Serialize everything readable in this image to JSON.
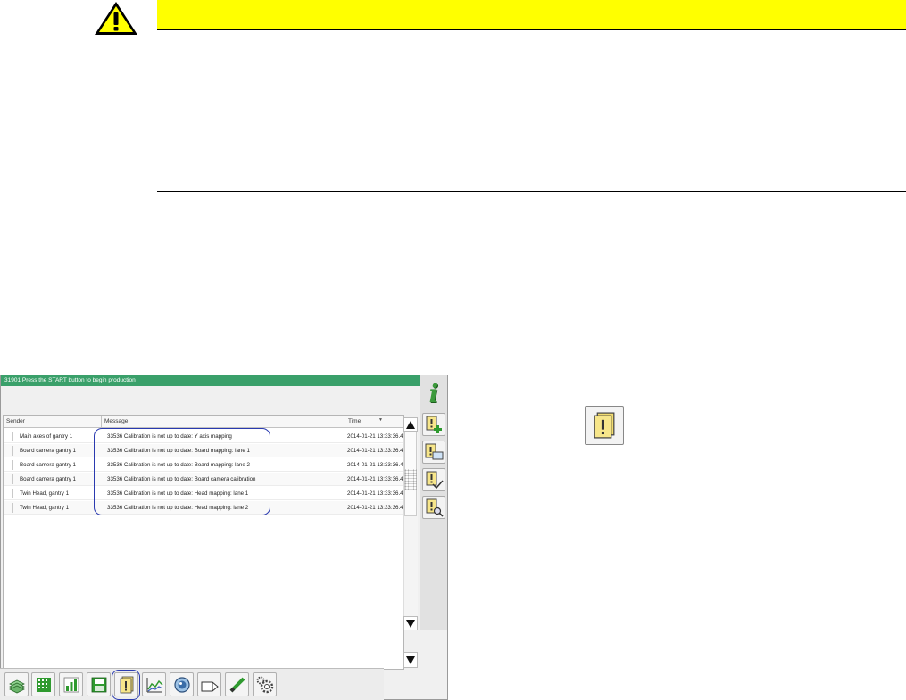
{
  "warning": {
    "icon": "warning-triangle-icon"
  },
  "screen": {
    "status_message": "31901 Press the START button to begin production",
    "columns": {
      "sender": "Sender",
      "message": "Message",
      "time": "Time"
    },
    "rows": [
      {
        "sender": "Main axes of gantry 1",
        "message": "33536 Calibration is not up to date: Y axis mapping",
        "time": "2014-01-21 13:33:36.4"
      },
      {
        "sender": "Board camera gantry 1",
        "message": "33536 Calibration is not up to date: Board mapping: lane 1",
        "time": "2014-01-21 13:33:36.4"
      },
      {
        "sender": "Board camera gantry 1",
        "message": "33536 Calibration is not up to date: Board mapping: lane 2",
        "time": "2014-01-21 13:33:36.4"
      },
      {
        "sender": "Board camera gantry 1",
        "message": "33536 Calibration is not up to date: Board camera calibration",
        "time": "2014-01-21 13:33:36.4"
      },
      {
        "sender": "Twin Head, gantry 1",
        "message": "33536 Calibration is not up to date: Head mapping: lane 1",
        "time": "2014-01-21 13:33:36.4"
      },
      {
        "sender": "Twin Head, gantry 1",
        "message": "33536 Calibration is not up to date: Head mapping: lane 2",
        "time": "2014-01-21 13:33:36.4"
      }
    ]
  },
  "colors": {
    "status_bar": "#3aa06a",
    "warning_bar": "#ffff00",
    "highlight": "#2a3ab0",
    "info_icon": "#3c9a3c"
  },
  "icons": {
    "side": [
      "info-icon",
      "add-message-icon",
      "message-screen-icon",
      "message-acknowledge-icon",
      "message-search-icon"
    ],
    "taskbar": [
      "production-icon",
      "board-grid-icon",
      "statistics-icon",
      "save-icon",
      "messages-icon",
      "chart-icon",
      "camera-icon",
      "feeder-icon",
      "nozzle-icon",
      "settings-icon"
    ],
    "callout": "messages-icon"
  }
}
